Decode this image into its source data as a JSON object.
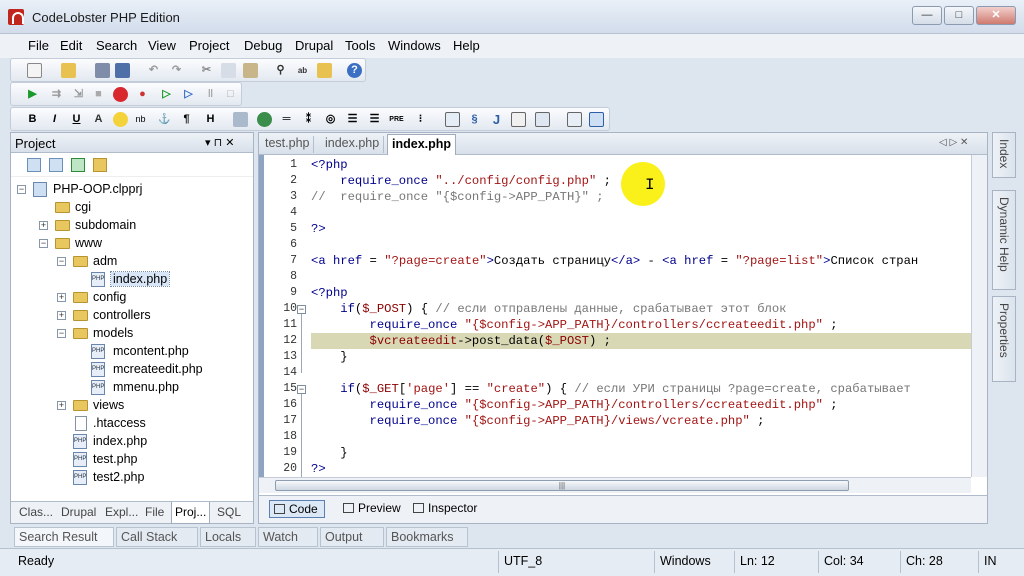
{
  "window": {
    "title": "CodeLobster PHP Edition",
    "min": "—",
    "max": "□",
    "close": "✕"
  },
  "menu": [
    "File",
    "Edit",
    "Search",
    "View",
    "Project",
    "Debug",
    "Drupal",
    "Tools",
    "Windows",
    "Help"
  ],
  "format_toolbar": {
    "bold": "B",
    "italic": "I",
    "underline": "U",
    "font": "A",
    "nb": "nb",
    "para": "¶",
    "heading": "H",
    "pre": "PRE",
    "j": "J"
  },
  "project_panel": {
    "title": "Project",
    "pin": "▾ ⊓ ✕",
    "tree": [
      {
        "label": "PHP-OOP.clpprj",
        "kind": "project",
        "level": 0,
        "expander": "−"
      },
      {
        "label": "cgi",
        "kind": "folder",
        "level": 1,
        "expander": ""
      },
      {
        "label": "subdomain",
        "kind": "folder",
        "level": 1,
        "expander": "+"
      },
      {
        "label": "www",
        "kind": "folder",
        "level": 1,
        "expander": "−"
      },
      {
        "label": "adm",
        "kind": "folder",
        "level": 2,
        "expander": "−"
      },
      {
        "label": "index.php",
        "kind": "php",
        "level": 3,
        "expander": "",
        "selected": true
      },
      {
        "label": "config",
        "kind": "folder",
        "level": 2,
        "expander": "+"
      },
      {
        "label": "controllers",
        "kind": "folder",
        "level": 2,
        "expander": "+"
      },
      {
        "label": "models",
        "kind": "folder",
        "level": 2,
        "expander": "−"
      },
      {
        "label": "mcontent.php",
        "kind": "php",
        "level": 3,
        "expander": ""
      },
      {
        "label": "mcreateedit.php",
        "kind": "php",
        "level": 3,
        "expander": ""
      },
      {
        "label": "mmenu.php",
        "kind": "php",
        "level": 3,
        "expander": ""
      },
      {
        "label": "views",
        "kind": "folder",
        "level": 2,
        "expander": "+"
      },
      {
        "label": ".htaccess",
        "kind": "file",
        "level": 2,
        "expander": ""
      },
      {
        "label": "index.php",
        "kind": "php",
        "level": 2,
        "expander": ""
      },
      {
        "label": "test.php",
        "kind": "php",
        "level": 2,
        "expander": ""
      },
      {
        "label": "test2.php",
        "kind": "php",
        "level": 2,
        "expander": ""
      }
    ],
    "bottom_tabs": [
      "Clas...",
      "Drupal",
      "Expl...",
      "File",
      "Proj...",
      "SQL"
    ],
    "active_bottom_tab": "Proj..."
  },
  "editor": {
    "tabs": [
      "test.php",
      "index.php",
      "index.php"
    ],
    "active_tab": 2,
    "nav": "◁ ▷ ✕",
    "line_numbers": [
      "1",
      "2",
      "3",
      "4",
      "5",
      "6",
      "7",
      "8",
      "9",
      "10",
      "11",
      "12",
      "13",
      "14",
      "15",
      "16",
      "17",
      "18",
      "19",
      "20"
    ],
    "highlight_line": 12,
    "view_tabs": [
      "Code",
      "Preview",
      "Inspector"
    ],
    "active_view": "Code",
    "scroll_grip": "|||"
  },
  "right_dock": [
    "Index",
    "Dynamic Help",
    "Properties"
  ],
  "output_tabs": [
    "Search Result",
    "Call Stack",
    "Locals",
    "Watch",
    "Output",
    "Bookmarks"
  ],
  "status": {
    "state": "Ready",
    "encoding": "UTF_8",
    "line_endings": "Windows",
    "line": "Ln: 12",
    "col": "Col: 34",
    "ch": "Ch: 28",
    "mode": "IN"
  }
}
